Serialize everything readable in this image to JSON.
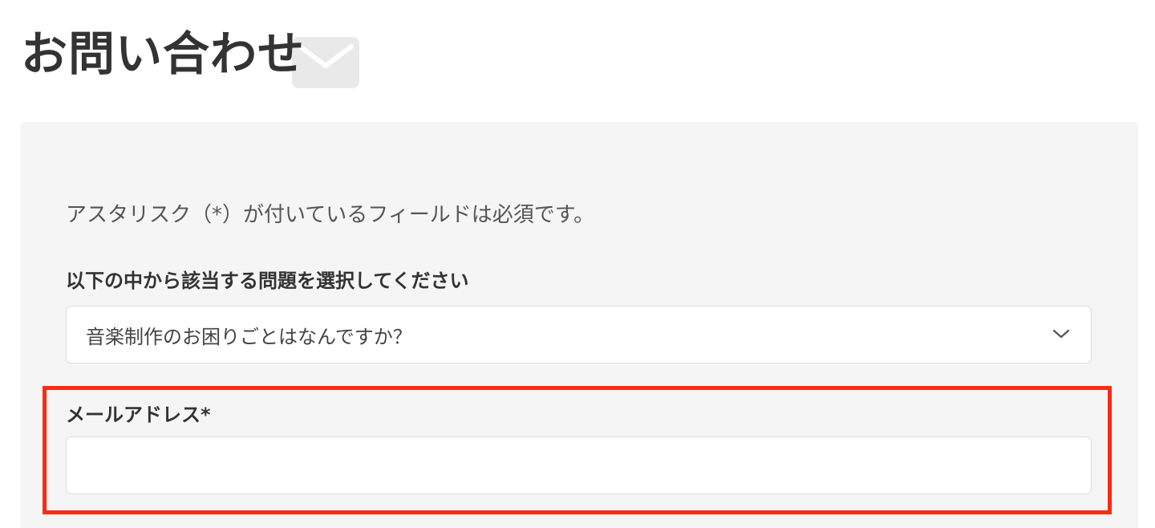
{
  "header": {
    "title": "お問い合わせ",
    "icon": "mail-icon"
  },
  "form": {
    "required_note": "アスタリスク（*）が付いているフィールドは必須です。",
    "issue_select": {
      "label": "以下の中から該当する問題を選択してください",
      "selected_value": "音楽制作のお困りごとはなんですか？",
      "icon": "chevron-down-icon"
    },
    "email_field": {
      "label": "メールアドレス*",
      "value": "",
      "placeholder": ""
    }
  },
  "annotation": {
    "highlight_color": "#ff2a12"
  },
  "colors": {
    "panel_background": "#f5f5f5",
    "text": "#333333"
  }
}
